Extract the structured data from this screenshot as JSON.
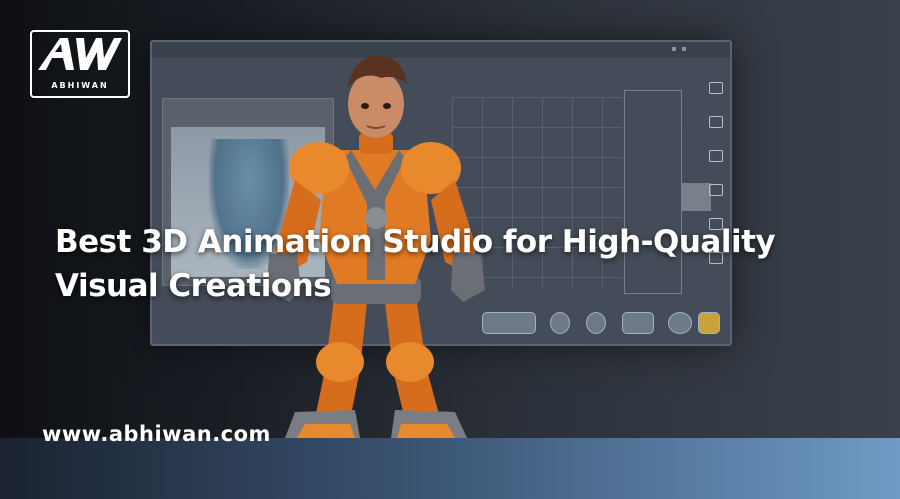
{
  "brand": {
    "logo_text": "ABHIWAN",
    "logo_monogram": "AW"
  },
  "headline": "Best 3D Animation Studio for High-Quality Visual Creations",
  "website": "www.abhiwan.com",
  "colors": {
    "text": "#ffffff",
    "background_dark": "#0d0f13",
    "floor_accent": "#6f9bc6",
    "character_orange": "#e07a24",
    "character_gray": "#6b6f75"
  }
}
